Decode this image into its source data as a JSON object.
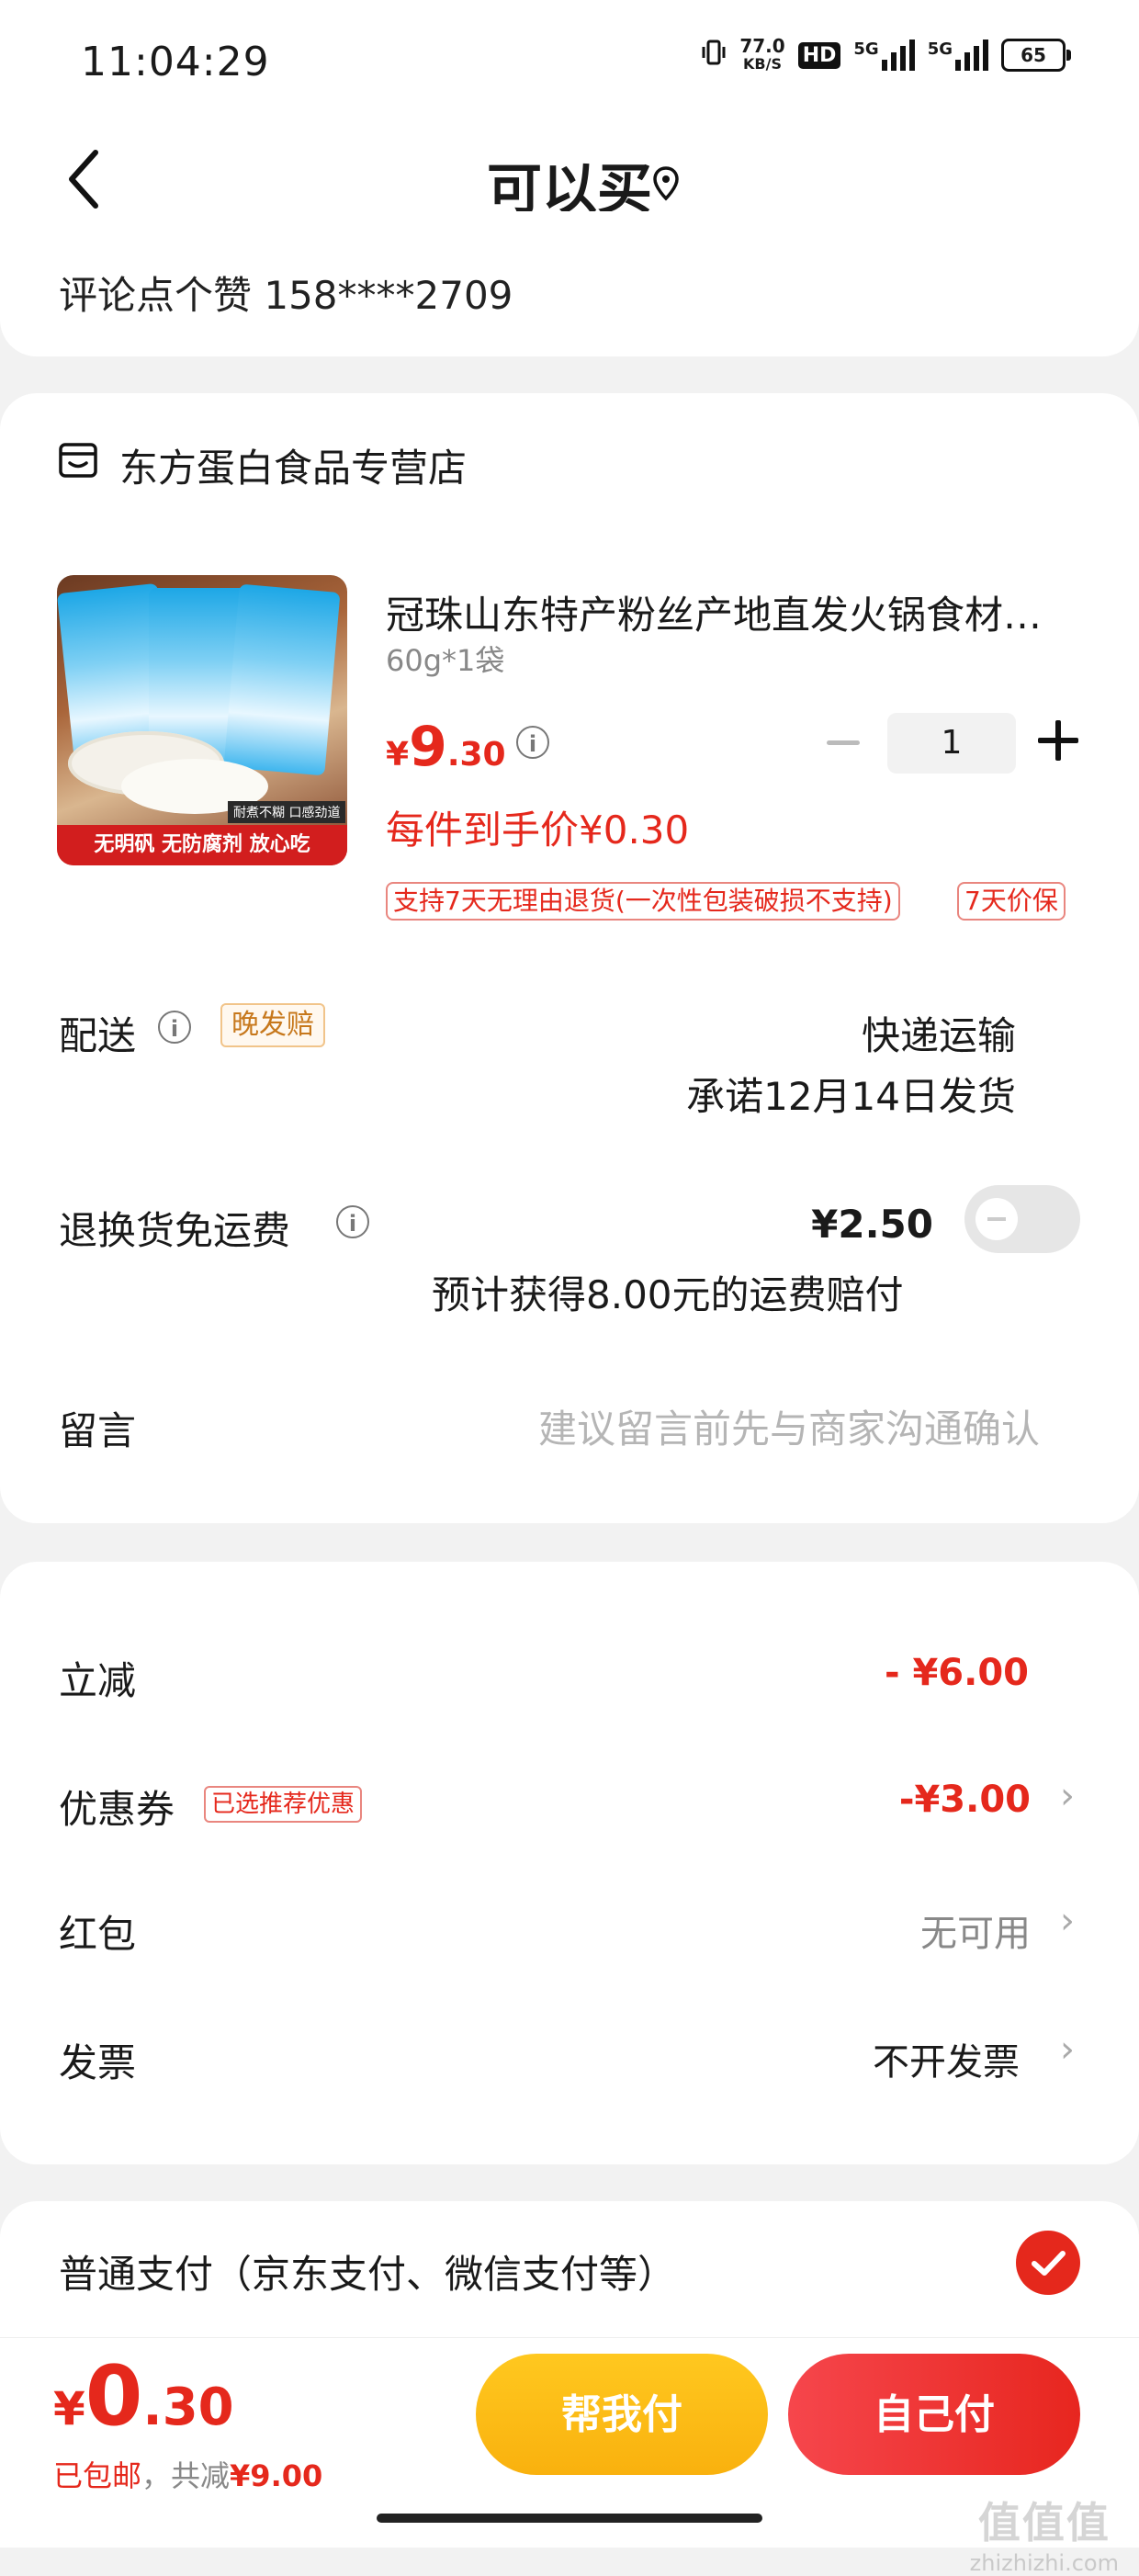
{
  "status_bar": {
    "time": "11:04:29",
    "net_speed_value": "77.0",
    "net_speed_unit": "KB/S",
    "hd_label": "HD",
    "sim1_label": "5G",
    "sim2_label": "5G",
    "battery": "65"
  },
  "header": {
    "title": "可以买",
    "back_icon": "chevron-left-icon",
    "location_icon": "location-pin-icon"
  },
  "address": {
    "name_line": "评论点个赞  158****2709"
  },
  "order": {
    "store_name": "东方蛋白食品专营店",
    "store_icon": "store-icon",
    "product": {
      "title": "冠珠山东特产粉丝产地直发火锅食材细粉丝",
      "spec": "60g*1袋",
      "price_currency": "¥",
      "price_int": "9",
      "price_dec": ".30",
      "quantity": "1",
      "unit_price": "每件到手价¥0.30",
      "tags": [
        "支持7天无理由退货(一次性包装破损不支持)",
        "7天价保"
      ],
      "image_banner": "无明矾 无防腐剂 放心吃",
      "image_badge": "耐煮不糊 口感劲道"
    },
    "shipping": {
      "label": "配送",
      "late_tag": "晚发赔",
      "method": "快递运输",
      "promise": "承诺12月14日发货"
    },
    "return_shipping": {
      "label": "退换货免运费",
      "price": "¥2.50",
      "compensation": "预计获得8.00元的运费赔付",
      "enabled": false
    },
    "message": {
      "label": "留言",
      "placeholder": "建议留言前先与商家沟通确认"
    }
  },
  "discounts": {
    "instant": {
      "label": "立减",
      "value": "- ¥6.00"
    },
    "coupon": {
      "label": "优惠券",
      "tag": "已选推荐优惠",
      "value": "-¥3.00"
    },
    "red_packet": {
      "label": "红包",
      "value": "无可用"
    },
    "invoice": {
      "label": "发票",
      "value": "不开发票"
    }
  },
  "payment": {
    "method_label": "普通支付（京东支付、微信支付等）",
    "selected": true
  },
  "bottom": {
    "total_currency": "¥",
    "total_int": "0",
    "total_dec": ".30",
    "free_shipping": "已包邮",
    "saved_prefix": "，共减",
    "saved_amount": "¥9.00",
    "help_pay_label": "帮我付",
    "self_pay_label": "自己付"
  },
  "watermark": {
    "logo": "值值值",
    "site": "zhizhizhi.com"
  },
  "colors": {
    "accent_red": "#e5281c",
    "help_yellow": "#ffc81f",
    "self_red": "#f03a35"
  }
}
